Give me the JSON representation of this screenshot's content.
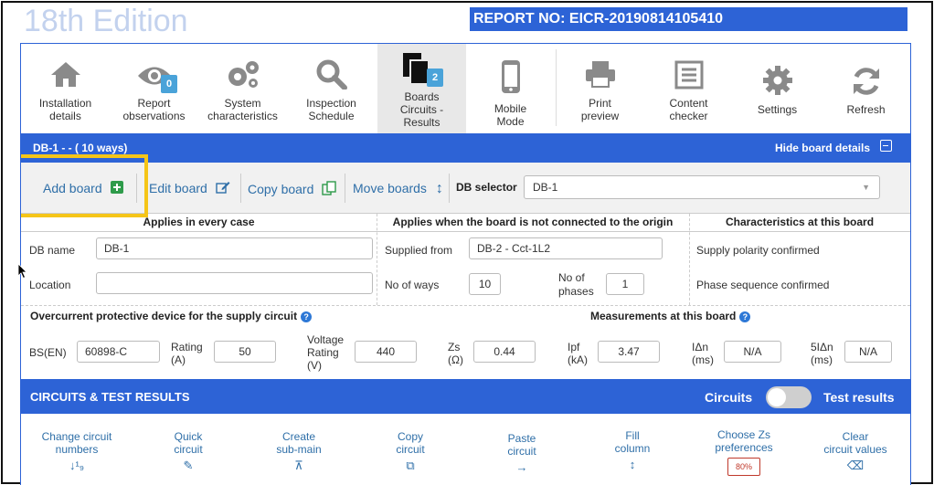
{
  "edition": "18th Edition",
  "report_no": "REPORT NO: EICR-20190814105410",
  "toolbar": [
    {
      "id": "installation",
      "label1": "Installation",
      "label2": "details",
      "icon": "house-icon"
    },
    {
      "id": "observations",
      "label1": "Report",
      "label2": "observations",
      "icon": "eye-icon",
      "badge": "0"
    },
    {
      "id": "system",
      "label1": "System",
      "label2": "characteristics",
      "icon": "gears-icon"
    },
    {
      "id": "inspection",
      "label1": "Inspection",
      "label2": "Schedule",
      "icon": "magnifier-icon"
    },
    {
      "id": "boards",
      "label1": "Boards",
      "label2": "Circuits -",
      "label3": "Results",
      "icon": "documents-icon",
      "badge": "2"
    },
    {
      "id": "mobile",
      "label1": "Mobile",
      "label2": "Mode",
      "icon": "phone-icon"
    },
    {
      "id": "print",
      "label1": "Print",
      "label2": "preview",
      "icon": "printer-icon"
    },
    {
      "id": "content",
      "label1": "Content",
      "label2": "checker",
      "icon": "checklist-icon"
    },
    {
      "id": "settings",
      "label1": "Settings",
      "icon": "gear-icon"
    },
    {
      "id": "refresh",
      "label1": "Refresh",
      "icon": "refresh-icon"
    }
  ],
  "board_header": {
    "title": "DB-1 -  - ( 10 ways)",
    "hide_label": "Hide board details"
  },
  "actions": {
    "add": "Add board",
    "edit": "Edit board",
    "copy": "Copy board",
    "move": "Move boards",
    "db_selector_label": "DB selector",
    "db_selector_value": "DB-1"
  },
  "sections": {
    "every_case": "Applies in every case",
    "not_origin": "Applies when the board is not connected to the origin",
    "characteristics": "Characteristics at this board"
  },
  "fields": {
    "db_name_label": "DB name",
    "db_name_value": "DB-1",
    "location_label": "Location",
    "location_value": "",
    "supplied_from_label": "Supplied from",
    "supplied_from_value": "DB-2 - Cct-1L2",
    "no_of_ways_label": "No of ways",
    "no_of_ways_value": "10",
    "no_of_phases_label1": "No of",
    "no_of_phases_label2": "phases",
    "no_of_phases_value": "1",
    "polarity": "Supply polarity confirmed",
    "phase_seq": "Phase sequence confirmed"
  },
  "ocpd": {
    "title": "Overcurrent protective device for the supply circuit",
    "measurements_title": "Measurements at this board",
    "bsen_label": "BS(EN)",
    "bsen_value": "60898-C",
    "rating_label1": "Rating",
    "rating_label2": "(A)",
    "rating_value": "50",
    "voltage_label1": "Voltage",
    "voltage_label2": "Rating",
    "voltage_label3": "(V)",
    "voltage_value": "440",
    "zs_label1": "Zs",
    "zs_label2": "(Ω)",
    "zs_value": "0.44",
    "ipf_label1": "Ipf",
    "ipf_label2": "(kA)",
    "ipf_value": "3.47",
    "idn_label1": "IΔn",
    "idn_label2": "(ms)",
    "idn_value": "N/A",
    "idn5_label1": "5IΔn",
    "idn5_label2": "(ms)",
    "idn5_value": "N/A"
  },
  "circuits_header": {
    "title": "CIRCUITS & TEST RESULTS",
    "toggle_left": "Circuits",
    "toggle_right": "Test results"
  },
  "circuit_tools": [
    {
      "l1": "Change circuit",
      "l2": "numbers",
      "icon": "↓¹₉"
    },
    {
      "l1": "Quick",
      "l2": "circuit",
      "icon": "✎"
    },
    {
      "l1": "Create",
      "l2": "sub-main",
      "icon": "⊼"
    },
    {
      "l1": "Copy",
      "l2": "circuit",
      "icon": "⧉"
    },
    {
      "l1": "Paste",
      "l2": "circuit",
      "icon": "→"
    },
    {
      "l1": "Fill",
      "l2": "column",
      "icon": "↕"
    },
    {
      "l1": "Choose Zs",
      "l2": "preferences",
      "badge": "80%"
    },
    {
      "l1": "Clear",
      "l2": "circuit values",
      "icon": "⌫"
    }
  ]
}
